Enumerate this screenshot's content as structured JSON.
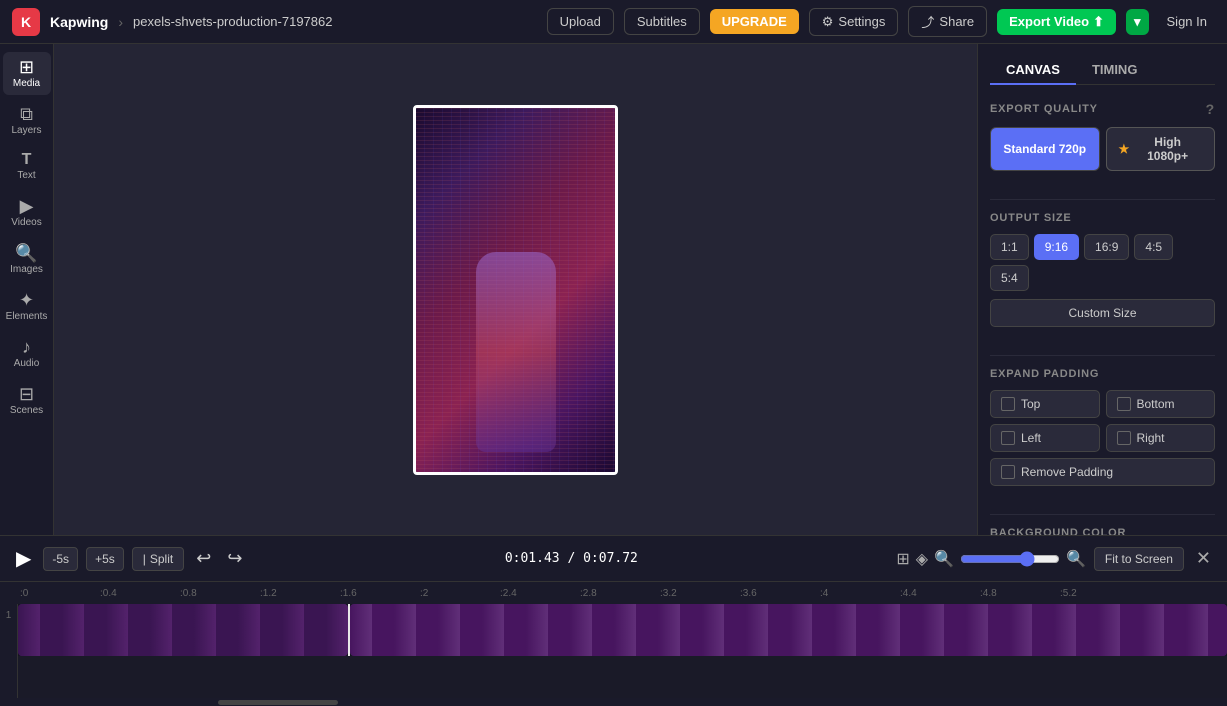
{
  "nav": {
    "brand": "Kapwing",
    "separator": "›",
    "project": "pexels-shvets-production-7197862",
    "upload_label": "Upload",
    "subtitles_label": "Subtitles",
    "upgrade_label": "UPGRADE",
    "settings_label": "Settings",
    "share_label": "Share",
    "export_label": "Export Video",
    "signin_label": "Sign In"
  },
  "sidebar": {
    "items": [
      {
        "id": "media",
        "label": "Media",
        "icon": "⊞"
      },
      {
        "id": "layers",
        "label": "Layers",
        "icon": "⧉"
      },
      {
        "id": "text",
        "label": "Text",
        "icon": "T"
      },
      {
        "id": "videos",
        "label": "Videos",
        "icon": "▶"
      },
      {
        "id": "images",
        "label": "Images",
        "icon": "🔍"
      },
      {
        "id": "elements",
        "label": "Elements",
        "icon": "✦"
      },
      {
        "id": "audio",
        "label": "Audio",
        "icon": "♪"
      },
      {
        "id": "scenes",
        "label": "Scenes",
        "icon": "⊟"
      }
    ]
  },
  "right_panel": {
    "tabs": [
      {
        "id": "canvas",
        "label": "CANVAS",
        "active": true
      },
      {
        "id": "timing",
        "label": "TIMING",
        "active": false
      }
    ],
    "export_quality": {
      "title": "EXPORT QUALITY",
      "standard_label": "Standard 720p",
      "high_label": "High 1080p+",
      "star": "★"
    },
    "output_size": {
      "title": "OUTPUT SIZE",
      "options": [
        "1:1",
        "9:16",
        "16:9",
        "4:5",
        "5:4"
      ],
      "active": "9:16",
      "custom_label": "Custom Size"
    },
    "expand_padding": {
      "title": "EXPAND PADDING",
      "options": [
        "Top",
        "Bottom",
        "Left",
        "Right"
      ],
      "remove_label": "Remove Padding"
    },
    "background_color": {
      "title": "BACKGROUND COLOR",
      "hex_value": "#ffffff",
      "swatches": [
        "#000000",
        "#333333",
        "#e63946",
        "#f5a623",
        "#2196f3"
      ]
    }
  },
  "transport": {
    "skip_back_label": "-5s",
    "skip_forward_label": "+5s",
    "split_label": "Split",
    "timecode": "0:01.43 / 0:07.72",
    "fit_screen_label": "Fit to Screen"
  },
  "timeline": {
    "ruler_ticks": [
      ":0",
      ":0.4",
      ":0.8",
      ":1.2",
      ":1.6",
      ":2",
      ":2.4",
      ":2.8",
      ":3.2",
      ":3.6",
      ":4",
      ":4.4",
      ":4.8",
      ":5.2"
    ],
    "track_number": "1"
  }
}
